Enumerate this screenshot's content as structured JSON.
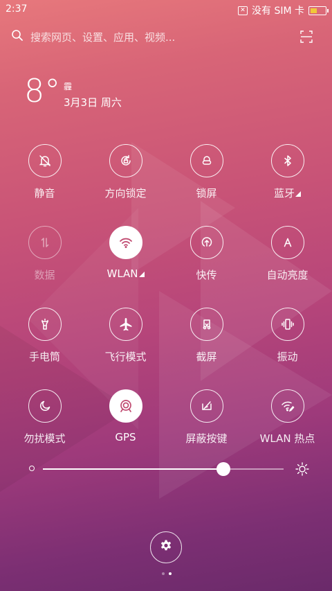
{
  "status": {
    "time": "2:37",
    "sim": "没有 SIM 卡",
    "sim_icon": "no-sim-icon",
    "battery_icon": "battery-icon",
    "battery_level": 0.5,
    "battery_color": "#f0c83a"
  },
  "search": {
    "placeholder": "搜索网页、设置、应用、视频...",
    "icon": "search-icon",
    "scan_icon": "scan-icon"
  },
  "weather": {
    "temperature": "8°",
    "condition": "霾",
    "date": "3月3日 周六"
  },
  "toggles": [
    {
      "label": "静音",
      "icon": "mute-icon",
      "state": "off"
    },
    {
      "label": "方向锁定",
      "icon": "rotation-lock-icon",
      "state": "off"
    },
    {
      "label": "锁屏",
      "icon": "lock-icon",
      "state": "off"
    },
    {
      "label": "蓝牙",
      "icon": "bluetooth-icon",
      "state": "off",
      "has_more": true
    },
    {
      "label": "数据",
      "icon": "mobile-data-icon",
      "state": "disabled"
    },
    {
      "label": "WLAN",
      "icon": "wifi-icon",
      "state": "on",
      "has_more": true
    },
    {
      "label": "快传",
      "icon": "quick-transfer-icon",
      "state": "off"
    },
    {
      "label": "自动亮度",
      "icon": "auto-brightness-icon",
      "state": "off"
    },
    {
      "label": "手电筒",
      "icon": "flashlight-icon",
      "state": "off"
    },
    {
      "label": "飞行模式",
      "icon": "airplane-icon",
      "state": "off"
    },
    {
      "label": "截屏",
      "icon": "screenshot-icon",
      "state": "off"
    },
    {
      "label": "振动",
      "icon": "vibrate-icon",
      "state": "off"
    },
    {
      "label": "勿扰模式",
      "icon": "moon-icon",
      "state": "off"
    },
    {
      "label": "GPS",
      "icon": "gps-icon",
      "state": "on"
    },
    {
      "label": "屏蔽按键",
      "icon": "block-keys-icon",
      "state": "off"
    },
    {
      "label": "WLAN 热点",
      "icon": "hotspot-icon",
      "state": "off"
    }
  ],
  "brightness": {
    "value": 0.75,
    "low_icon": "brightness-low-icon",
    "high_icon": "sun-icon"
  },
  "footer": {
    "settings_icon": "gear-icon",
    "page_count": 2,
    "current_page": 2
  },
  "colors": {
    "accent": "#c04a70",
    "background_top": "#e7787c",
    "background_bottom": "#6a2a6a"
  }
}
